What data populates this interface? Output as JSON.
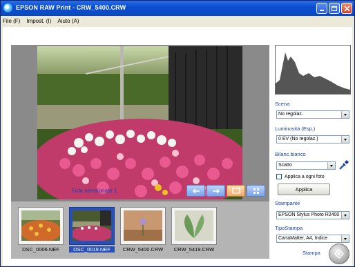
{
  "window": {
    "title": "EPSON RAW Print - CRW_5400.CRW"
  },
  "menu": [
    "File (F)",
    "Impost. (I)",
    "Aiuto (A)"
  ],
  "preview": {
    "selected_text": "Foto selezionate 1",
    "view_buttons": [
      "arrow-left-icon",
      "arrow-right-icon",
      "single-view-icon",
      "grid-view-icon"
    ]
  },
  "thumbnails": [
    {
      "name": "DSC_0006.NEF",
      "selected": false
    },
    {
      "name": "DSC_0019.NEF",
      "selected": true
    },
    {
      "name": "CRW_5400.CRW",
      "selected": false
    },
    {
      "name": "CRW_5419.CRW",
      "selected": false
    }
  ],
  "panel": {
    "scene_label": "Scena",
    "scene_value": "No regolaz.",
    "brightness_label": "Luminosità (Esp.)",
    "brightness_value": "0 EV (No regolaz.)",
    "wb_label": "Bilanc.bianco",
    "wb_value": "Scatto",
    "apply_all_label": "Applica a ogni foto",
    "apply_all_checked": false,
    "apply_button": "Applica",
    "printer_label": "Stampante",
    "printer_value": "EPSON Stylus Photo R2400",
    "print_type_label": "TipoStampa",
    "print_type_value": "CartaMatter, A4, Indice",
    "print_label": "Stampa"
  }
}
